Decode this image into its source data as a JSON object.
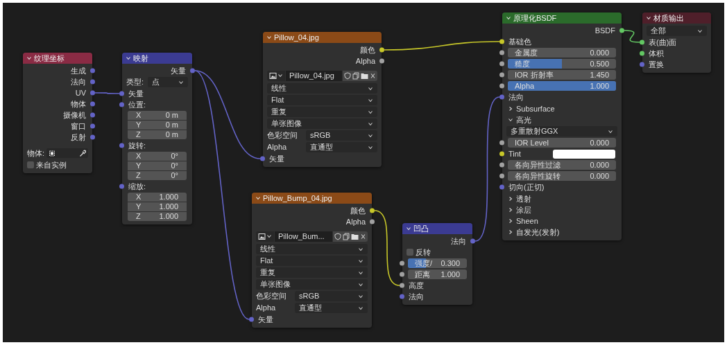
{
  "nodes": [
    {
      "title": "纹理坐标",
      "color": "#8a2b44",
      "rows": [
        {
          "kind": "output",
          "label": "生成",
          "socket": {
            "kind": "vector"
          }
        },
        {
          "kind": "output",
          "label": "法向",
          "socket": {
            "kind": "vector"
          }
        },
        {
          "kind": "output",
          "label": "UV",
          "socket": {
            "kind": "vector"
          }
        },
        {
          "kind": "output",
          "label": "物体",
          "socket": {
            "kind": "vector"
          }
        },
        {
          "kind": "output",
          "label": "摄像机",
          "socket": {
            "kind": "vector"
          }
        },
        {
          "kind": "output",
          "label": "窗口",
          "socket": {
            "kind": "vector"
          }
        },
        {
          "kind": "output",
          "label": "反射",
          "socket": {
            "kind": "vector"
          }
        },
        {
          "kind": "object",
          "label": "物体:"
        },
        {
          "kind": "checkbox",
          "label": "来自实例",
          "checked": false
        }
      ]
    },
    {
      "title": "映射",
      "color": "#3b3b92",
      "rows": [
        {
          "kind": "output",
          "label": "矢量",
          "socket": {
            "kind": "vector"
          }
        },
        {
          "kind": "dropdown",
          "label": "类型:",
          "value": "点"
        },
        {
          "kind": "input",
          "label": "矢量",
          "socket": {
            "kind": "vector"
          }
        },
        {
          "kind": "input",
          "label": "位置:",
          "socket": {
            "kind": "vector"
          }
        },
        {
          "kind": "vector",
          "items": [
            {
              "axis": "X",
              "value": "0 m"
            },
            {
              "axis": "Y",
              "value": "0 m"
            },
            {
              "axis": "Z",
              "value": "0 m"
            }
          ]
        },
        {
          "kind": "input",
          "label": "旋转:",
          "socket": {
            "kind": "vector"
          }
        },
        {
          "kind": "vector",
          "items": [
            {
              "axis": "X",
              "value": "0°"
            },
            {
              "axis": "Y",
              "value": "0°"
            },
            {
              "axis": "Z",
              "value": "0°"
            }
          ]
        },
        {
          "kind": "input",
          "label": "缩放:",
          "socket": {
            "kind": "vector"
          }
        },
        {
          "kind": "vector",
          "items": [
            {
              "axis": "X",
              "value": "1.000"
            },
            {
              "axis": "Y",
              "value": "1.000"
            },
            {
              "axis": "Z",
              "value": "1.000"
            }
          ]
        }
      ]
    },
    {
      "title": "Pillow_04.jpg",
      "color": "#8b4a17",
      "rows": [
        {
          "kind": "output",
          "label": "颜色",
          "socket": {
            "kind": "color"
          }
        },
        {
          "kind": "output",
          "label": "Alpha",
          "socket": {
            "kind": "float"
          }
        },
        {
          "kind": "image",
          "value": "Pillow_04.jpg"
        },
        {
          "kind": "dropdown",
          "value": "线性"
        },
        {
          "kind": "dropdown",
          "value": "Flat"
        },
        {
          "kind": "dropdown",
          "value": "重复"
        },
        {
          "kind": "dropdown",
          "value": "单张图像"
        },
        {
          "kind": "dropdown",
          "label": "色彩空间",
          "value": "sRGB"
        },
        {
          "kind": "dropdown",
          "label": "Alpha",
          "value": "直通型"
        },
        {
          "kind": "input",
          "label": "矢量",
          "socket": {
            "kind": "vector"
          }
        }
      ]
    },
    {
      "title": "Pillow_Bump_04.jpg",
      "color": "#8b4a17",
      "rows": [
        {
          "kind": "output",
          "label": "颜色",
          "socket": {
            "kind": "color"
          }
        },
        {
          "kind": "output",
          "label": "Alpha",
          "socket": {
            "kind": "float"
          }
        },
        {
          "kind": "image",
          "value": "Pillow_Bum..."
        },
        {
          "kind": "dropdown",
          "value": "线性"
        },
        {
          "kind": "dropdown",
          "value": "Flat"
        },
        {
          "kind": "dropdown",
          "value": "重复"
        },
        {
          "kind": "dropdown",
          "value": "单张图像"
        },
        {
          "kind": "dropdown",
          "label": "色彩空间",
          "value": "sRGB"
        },
        {
          "kind": "dropdown",
          "label": "Alpha",
          "value": "直通型"
        },
        {
          "kind": "input",
          "label": "矢量",
          "socket": {
            "kind": "vector"
          }
        }
      ]
    },
    {
      "title": "凹凸",
      "color": "#3b3b92",
      "rows": [
        {
          "kind": "output",
          "label": "法向",
          "socket": {
            "kind": "vector"
          }
        },
        {
          "kind": "checkbox",
          "label": "反转",
          "checked": false
        },
        {
          "kind": "slider",
          "label": "强度/",
          "value": "0.300",
          "level": 0.3,
          "socket": {
            "kind": "float"
          }
        },
        {
          "kind": "slider",
          "label": "距离",
          "value": "1.000",
          "level": 0,
          "socket": {
            "kind": "float"
          }
        },
        {
          "kind": "input",
          "label": "高度",
          "socket": {
            "kind": "float"
          }
        },
        {
          "kind": "input",
          "label": "法向",
          "socket": {
            "kind": "vector"
          }
        }
      ]
    },
    {
      "title": "原理化BSDF",
      "color": "#2b6b2b",
      "rows": [
        {
          "kind": "output",
          "label": "BSDF",
          "socket": {
            "kind": "shader"
          }
        },
        {
          "kind": "input",
          "label": "基础色",
          "socket": {
            "kind": "color"
          }
        },
        {
          "kind": "slider",
          "label": "金属度",
          "value": "0.000",
          "level": 0,
          "socket": {
            "kind": "float"
          }
        },
        {
          "kind": "slider",
          "label": "糙度",
          "value": "0.500",
          "level": 0.5,
          "socket": {
            "kind": "float"
          }
        },
        {
          "kind": "slider",
          "label": "IOR 折射率",
          "value": "1.450",
          "level": 0,
          "socket": {
            "kind": "float"
          }
        },
        {
          "kind": "slider",
          "label": "Alpha",
          "value": "1.000",
          "level": 1,
          "socket": {
            "kind": "float"
          }
        },
        {
          "kind": "input",
          "label": "法向",
          "socket": {
            "kind": "vector"
          }
        },
        {
          "kind": "panel",
          "label": "Subsurface",
          "expanded": false
        },
        {
          "kind": "panel",
          "label": "高光",
          "expanded": true
        },
        {
          "kind": "dropdown",
          "value": "多重散射GGX"
        },
        {
          "kind": "slider",
          "label": "IOR Level",
          "value": "0.000",
          "level": 0,
          "socket": {
            "kind": "float"
          }
        },
        {
          "kind": "swatch",
          "label": "Tint",
          "color": "#ffffff",
          "socket": {
            "kind": "color"
          }
        },
        {
          "kind": "slider",
          "label": "各向异性过滤",
          "value": "0.000",
          "level": 0,
          "socket": {
            "kind": "float"
          }
        },
        {
          "kind": "slider",
          "label": "各向异性旋转",
          "value": "0.000",
          "level": 0,
          "socket": {
            "kind": "float"
          }
        },
        {
          "kind": "input",
          "label": "切向(正切)",
          "socket": {
            "kind": "vector"
          }
        },
        {
          "kind": "panel",
          "label": "透射",
          "expanded": false
        },
        {
          "kind": "panel",
          "label": "涂层",
          "expanded": false
        },
        {
          "kind": "panel",
          "label": "Sheen",
          "expanded": false
        },
        {
          "kind": "panel",
          "label": "自发光(发射)",
          "expanded": false
        }
      ]
    },
    {
      "title": "材质输出",
      "color": "#4f1f2a",
      "rows": [
        {
          "kind": "dropdown",
          "value": "全部"
        },
        {
          "kind": "input",
          "label": "表(曲)面",
          "socket": {
            "kind": "shader"
          }
        },
        {
          "kind": "input",
          "label": "体积",
          "socket": {
            "kind": "shader"
          }
        },
        {
          "kind": "input",
          "label": "置换",
          "socket": {
            "kind": "vector"
          }
        }
      ]
    }
  ]
}
